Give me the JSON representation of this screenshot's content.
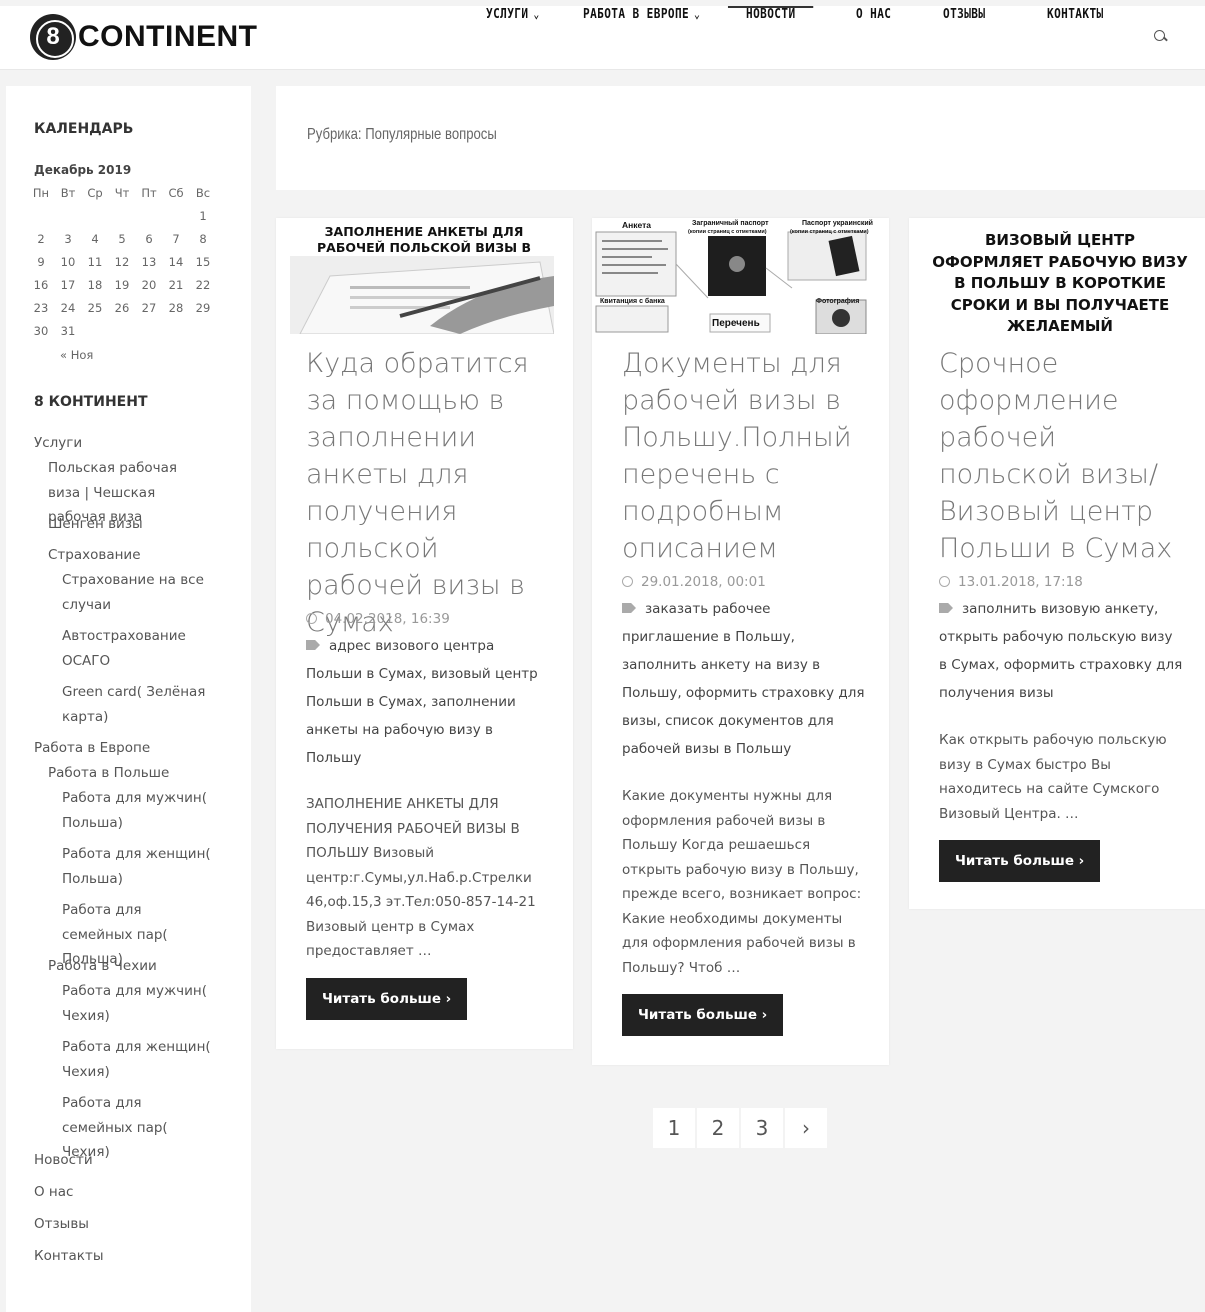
{
  "site": {
    "logo_mark": "8",
    "logo_text": "CONTINENT"
  },
  "nav": {
    "items": [
      {
        "label": "УСЛУГИ",
        "has_dropdown": true
      },
      {
        "label": "РАБОТА В ЕВРОПЕ",
        "has_dropdown": true
      },
      {
        "label": "НОВОСТИ",
        "active": true
      },
      {
        "label": "О НАС"
      },
      {
        "label": "ОТЗЫВЫ"
      },
      {
        "label": "КОНТАКТЫ"
      }
    ],
    "chevron": "⌄",
    "search_icon": "search-icon"
  },
  "sidebar": {
    "calendar_heading": "КАЛЕНДАРЬ",
    "calendar_month": "Декабрь 2019",
    "weekdays": [
      "Пн",
      "Вт",
      "Ср",
      "Чт",
      "Пт",
      "Сб",
      "Вс"
    ],
    "weeks": [
      [
        "",
        "",
        "",
        "",
        "",
        "",
        "1"
      ],
      [
        "2",
        "3",
        "4",
        "5",
        "6",
        "7",
        "8"
      ],
      [
        "9",
        "10",
        "11",
        "12",
        "13",
        "14",
        "15"
      ],
      [
        "16",
        "17",
        "18",
        "19",
        "20",
        "21",
        "22"
      ],
      [
        "23",
        "24",
        "25",
        "26",
        "27",
        "28",
        "29"
      ],
      [
        "30",
        "31",
        "",
        "",
        "",
        "",
        ""
      ]
    ],
    "prev_month": "« Ноя",
    "menu_heading": "8 КОНТИНЕНТ",
    "menu": [
      "Услуги",
      "Польская рабочая виза | Чешская рабочая виза",
      "Шенген визы",
      "Страхование",
      "Страхование на все случаи",
      "Автострахование ОСАГО",
      "Green card( Зелёная карта)",
      "Работа в Европе",
      "Работа в Польше",
      "Работа для мужчин( Польша)",
      "Работа для женщин( Польша)",
      "Работа для семейных пар( Польша)",
      "Работа в Чехии",
      "Работа для мужчин( Чехия)",
      "Работа для женщин( Чехия)",
      "Работа для семейных пар( Чехия)",
      "Новости",
      "О нас",
      "Отзывы",
      "Контакты"
    ]
  },
  "main": {
    "rubric": "Рубрика: Популярные вопросы",
    "cards": [
      {
        "image_caption": "ЗАПОЛНЕНИЕ АНКЕТЫ ДЛЯ РАБОЧЕЙ ПОЛЬСКОЙ ВИЗЫ В СУМАХ",
        "title": "Куда обратится за помощью в заполнении анкеты для получения польской рабочей визы в Сумах",
        "date": "04.02.2018, 16:39",
        "tags": "адрес визового центра Польши в Сумах, визовый центр Польши в Сумах, заполнении анкеты на рабочую визу в Польшу",
        "excerpt": "ЗАПОЛНЕНИЕ АНКЕТЫ ДЛЯ ПОЛУЧЕНИЯ РАБОЧЕЙ ВИЗЫ В ПОЛЬШУ Визовый центр:г.Сумы,ул.Наб.р.Стрелки 46,оф.15,3 эт.Тел:050-857-14-21 Визовый центр в Сумах предоставляет …",
        "button": "Читать больше  ›"
      },
      {
        "image_labels": [
          "Анкета",
          "Заграничный паспорт",
          "(копии страниц с отметками)",
          "Паспорт украинский",
          "(копии страниц с отметками)",
          "Квитанция с банка",
          "Перечень",
          "Фотография"
        ],
        "title": "Документы для рабочей визы в Польшу.Полный перечень с подробным описанием",
        "date": "29.01.2018, 00:01",
        "tags": "заказать рабочее приглашение в Польшу, заполнить анкету на визу в Польшу, оформить страховку для визы, список документов для рабочей визы в Польшу",
        "excerpt": "Какие документы нужны для оформления рабочей визы в Польшу Когда решаешься открыть рабочую визу в Польшу, прежде всего, возникает вопрос: Какие необходимы документы для оформления рабочей визы в Польшу? Чтоб …",
        "button": "Читать больше  ›"
      },
      {
        "image_caption": "ВИЗОВЫЙ ЦЕНТР ОФОРМЛЯЕТ РАБОЧУЮ ВИЗУ В ПОЛЬШУ В КОРОТКИЕ СРОКИ И ВЫ ПОЛУЧАЕТЕ ЖЕЛАЕМЫЙ",
        "title": "Срочное оформление рабочей польской визы/ Визовый центр Польши в Сумах",
        "date": "13.01.2018, 17:18",
        "tags": "заполнить визовую анкету, открыть рабочую польскую визу в Сумах, оформить страховку для получения визы",
        "excerpt": "Как открыть рабочую польскую визу в Сумах быстро  Вы находитесь на сайте Сумского Визовый Центра.   …",
        "button": "Читать больше  ›"
      }
    ],
    "pagination": [
      "1",
      "2",
      "3",
      "›"
    ]
  }
}
